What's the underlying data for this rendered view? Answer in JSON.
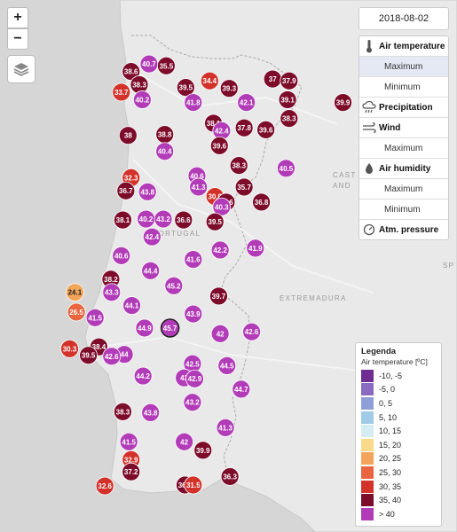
{
  "date": "2018-08-02",
  "regions": {
    "portugal": "PORTUGAL",
    "extremadura": "EXTREMADURA",
    "castilla_1": "CAST",
    "castilla_2": "AND",
    "spain_edge": "SP"
  },
  "panel": {
    "air_temperature": "Air temperature",
    "maximum_1": "Maximum",
    "minimum_1": "Minimum",
    "precipitation": "Precipitation",
    "wind": "Wind",
    "maximum_2": "Maximum",
    "air_humidity": "Air humidity",
    "maximum_3": "Maximum",
    "minimum_3": "Minimum",
    "atm_pressure": "Atm. pressure"
  },
  "legend": {
    "title": "Legenda",
    "subtitle": "Air temperature [ºC]",
    "classes": [
      {
        "label": "-10, -5",
        "color": "#6f2d91"
      },
      {
        "label": "-5, 0",
        "color": "#8a6bbf"
      },
      {
        "label": "0, 5",
        "color": "#8e9fd8"
      },
      {
        "label": "5, 10",
        "color": "#9fcbe6"
      },
      {
        "label": "10, 15",
        "color": "#d4ecf2"
      },
      {
        "label": "15, 20",
        "color": "#fbd98c"
      },
      {
        "label": "20, 25",
        "color": "#f2a55a"
      },
      {
        "label": "25, 30",
        "color": "#e8653f"
      },
      {
        "label": "30, 35",
        "color": "#d2322a"
      },
      {
        "label": "35, 40",
        "color": "#7d0b2a"
      },
      {
        "label": "> 40",
        "color": "#b23cb8"
      }
    ]
  },
  "stations": [
    {
      "label": "40.7",
      "lon": -8.39,
      "lat": 42.07
    },
    {
      "label": "35.5",
      "lon": -8.16,
      "lat": 42.05
    },
    {
      "label": "38.6",
      "lon": -8.63,
      "lat": 41.99
    },
    {
      "label": "34.4",
      "lon": -7.58,
      "lat": 41.89
    },
    {
      "label": "37",
      "lon": -6.74,
      "lat": 41.91
    },
    {
      "label": "37.9",
      "lon": -6.52,
      "lat": 41.89
    },
    {
      "label": "33.7",
      "lon": -8.76,
      "lat": 41.77
    },
    {
      "label": "38.3",
      "lon": -8.52,
      "lat": 41.85
    },
    {
      "label": "39.5",
      "lon": -7.9,
      "lat": 41.82
    },
    {
      "label": "39.3",
      "lon": -7.32,
      "lat": 41.81
    },
    {
      "label": "40.2",
      "lon": -8.48,
      "lat": 41.69
    },
    {
      "label": "41.8",
      "lon": -7.8,
      "lat": 41.66
    },
    {
      "label": "42.1",
      "lon": -7.09,
      "lat": 41.66
    },
    {
      "label": "39.1",
      "lon": -6.54,
      "lat": 41.69
    },
    {
      "label": "39.9",
      "lon": -5.8,
      "lat": 41.66
    },
    {
      "label": "38.3",
      "lon": -6.52,
      "lat": 41.49
    },
    {
      "label": "38.1",
      "lon": -7.53,
      "lat": 41.44
    },
    {
      "label": "37.8",
      "lon": -7.12,
      "lat": 41.39
    },
    {
      "label": "39.6",
      "lon": -6.83,
      "lat": 41.37
    },
    {
      "label": "42.4",
      "lon": -7.42,
      "lat": 41.36
    },
    {
      "label": "38",
      "lon": -8.67,
      "lat": 41.31
    },
    {
      "label": "38.8",
      "lon": -8.18,
      "lat": 41.32
    },
    {
      "label": "39.6",
      "lon": -7.45,
      "lat": 41.2
    },
    {
      "label": "40.4",
      "lon": -8.18,
      "lat": 41.14
    },
    {
      "label": "38.3",
      "lon": -7.19,
      "lat": 40.99
    },
    {
      "label": "40.5",
      "lon": -6.56,
      "lat": 40.96
    },
    {
      "label": "40.6",
      "lon": -7.75,
      "lat": 40.88
    },
    {
      "label": "32.3",
      "lon": -8.63,
      "lat": 40.86
    },
    {
      "label": "41.3",
      "lon": -7.73,
      "lat": 40.76
    },
    {
      "label": "35.7",
      "lon": -7.12,
      "lat": 40.76
    },
    {
      "label": "36.7",
      "lon": -8.7,
      "lat": 40.72
    },
    {
      "label": "43.8",
      "lon": -8.41,
      "lat": 40.71
    },
    {
      "label": "30.6",
      "lon": -7.51,
      "lat": 40.66
    },
    {
      "label": "39.6",
      "lon": -7.36,
      "lat": 40.6
    },
    {
      "label": "36.8",
      "lon": -6.89,
      "lat": 40.6
    },
    {
      "label": "40.3",
      "lon": -7.42,
      "lat": 40.55
    },
    {
      "label": "38.1",
      "lon": -8.74,
      "lat": 40.41
    },
    {
      "label": "40.2",
      "lon": -8.43,
      "lat": 40.42
    },
    {
      "label": "43.2",
      "lon": -8.2,
      "lat": 40.42
    },
    {
      "label": "36.6",
      "lon": -7.93,
      "lat": 40.41
    },
    {
      "label": "39.5",
      "lon": -7.51,
      "lat": 40.39
    },
    {
      "label": "42.4",
      "lon": -8.35,
      "lat": 40.23
    },
    {
      "label": "41.9",
      "lon": -6.97,
      "lat": 40.11
    },
    {
      "label": "42.2",
      "lon": -7.44,
      "lat": 40.09
    },
    {
      "label": "40.6",
      "lon": -8.76,
      "lat": 40.03
    },
    {
      "label": "41.6",
      "lon": -7.8,
      "lat": 39.99
    },
    {
      "label": "44.4",
      "lon": -8.37,
      "lat": 39.87
    },
    {
      "label": "38.2",
      "lon": -8.9,
      "lat": 39.78
    },
    {
      "label": "45.2",
      "lon": -8.06,
      "lat": 39.71
    },
    {
      "label": "24.1",
      "lon": -9.38,
      "lat": 39.64
    },
    {
      "label": "43.3",
      "lon": -8.89,
      "lat": 39.64
    },
    {
      "label": "39.7",
      "lon": -7.46,
      "lat": 39.6
    },
    {
      "label": "44.1",
      "lon": -8.62,
      "lat": 39.5
    },
    {
      "label": "26.5",
      "lon": -9.36,
      "lat": 39.43
    },
    {
      "label": "43.9",
      "lon": -7.8,
      "lat": 39.41
    },
    {
      "label": "41.5",
      "lon": -9.11,
      "lat": 39.37
    },
    {
      "label": "44.9",
      "lon": -8.45,
      "lat": 39.26
    },
    {
      "label": "45.7",
      "lon": -8.11,
      "lat": 39.26
    },
    {
      "label": "42",
      "lon": -7.44,
      "lat": 39.2
    },
    {
      "label": "42.6",
      "lon": -7.02,
      "lat": 39.22
    },
    {
      "label": "38.4",
      "lon": -9.06,
      "lat": 39.06
    },
    {
      "label": "30.3",
      "lon": -9.45,
      "lat": 39.04
    },
    {
      "label": "44",
      "lon": -8.72,
      "lat": 38.98
    },
    {
      "label": "39.5",
      "lon": -9.2,
      "lat": 38.97
    },
    {
      "label": "42.6",
      "lon": -8.89,
      "lat": 38.96
    },
    {
      "label": "42.5",
      "lon": -7.81,
      "lat": 38.88
    },
    {
      "label": "44.5",
      "lon": -7.35,
      "lat": 38.86
    },
    {
      "label": "44.2",
      "lon": -8.47,
      "lat": 38.75
    },
    {
      "label": "43",
      "lon": -7.92,
      "lat": 38.73
    },
    {
      "label": "42.9",
      "lon": -7.78,
      "lat": 38.72
    },
    {
      "label": "44.7",
      "lon": -7.16,
      "lat": 38.61
    },
    {
      "label": "43.2",
      "lon": -7.81,
      "lat": 38.47
    },
    {
      "label": "38.3",
      "lon": -8.74,
      "lat": 38.37
    },
    {
      "label": "43.8",
      "lon": -8.37,
      "lat": 38.36
    },
    {
      "label": "41.3",
      "lon": -7.37,
      "lat": 38.2
    },
    {
      "label": "41.5",
      "lon": -8.66,
      "lat": 38.05
    },
    {
      "label": "42",
      "lon": -7.92,
      "lat": 38.05
    },
    {
      "label": "39.9",
      "lon": -7.67,
      "lat": 37.96
    },
    {
      "label": "32.9",
      "lon": -8.63,
      "lat": 37.86
    },
    {
      "label": "37.2",
      "lon": -8.63,
      "lat": 37.73
    },
    {
      "label": "36.3",
      "lon": -7.31,
      "lat": 37.68
    },
    {
      "label": "32.6",
      "lon": -8.98,
      "lat": 37.58
    },
    {
      "label": "36.1",
      "lon": -7.91,
      "lat": 37.59
    },
    {
      "label": "31.5",
      "lon": -7.8,
      "lat": 37.59
    }
  ]
}
